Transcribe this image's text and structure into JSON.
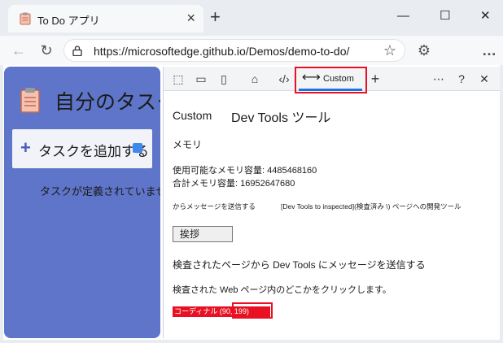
{
  "browser": {
    "tab_title": "To Do アプリ",
    "url": "https://microsoftedge.github.io/Demos/demo-to-do/"
  },
  "app": {
    "title": "自分のタスク",
    "add_task_label": "タスクを追加する",
    "empty_message": "タスクが定義されていません"
  },
  "devtools": {
    "active_tab": "Custom",
    "heading_prefix": "Custom",
    "heading": "Dev Tools ツール",
    "memory_title": "メモリ",
    "memory_available": "使用可能なメモリ容量: 4485468160",
    "memory_total": "合計メモリ容量: 16952647680",
    "message_from": "からメッセージを送信する",
    "message_to": "[Dev Tools to inspected](検査済み \\) ページへの開発ツール",
    "greet_button": "挨拶",
    "send_message_label": "検査されたページから Dev Tools にメッセージを送信する",
    "click_instruction": "検査された Web ページ内のどこかをクリックします。",
    "coordinates": "コーディナル (90, 199)"
  },
  "colors": {
    "app_bg": "#5e75c9",
    "accent": "#1a73e8",
    "callout": "#e81123"
  },
  "icons": [
    "clipboard-icon",
    "lock-icon",
    "star-icon",
    "refresh-icon",
    "back-icon",
    "extensions-icon",
    "more-icon",
    "help-icon",
    "close-icon"
  ]
}
